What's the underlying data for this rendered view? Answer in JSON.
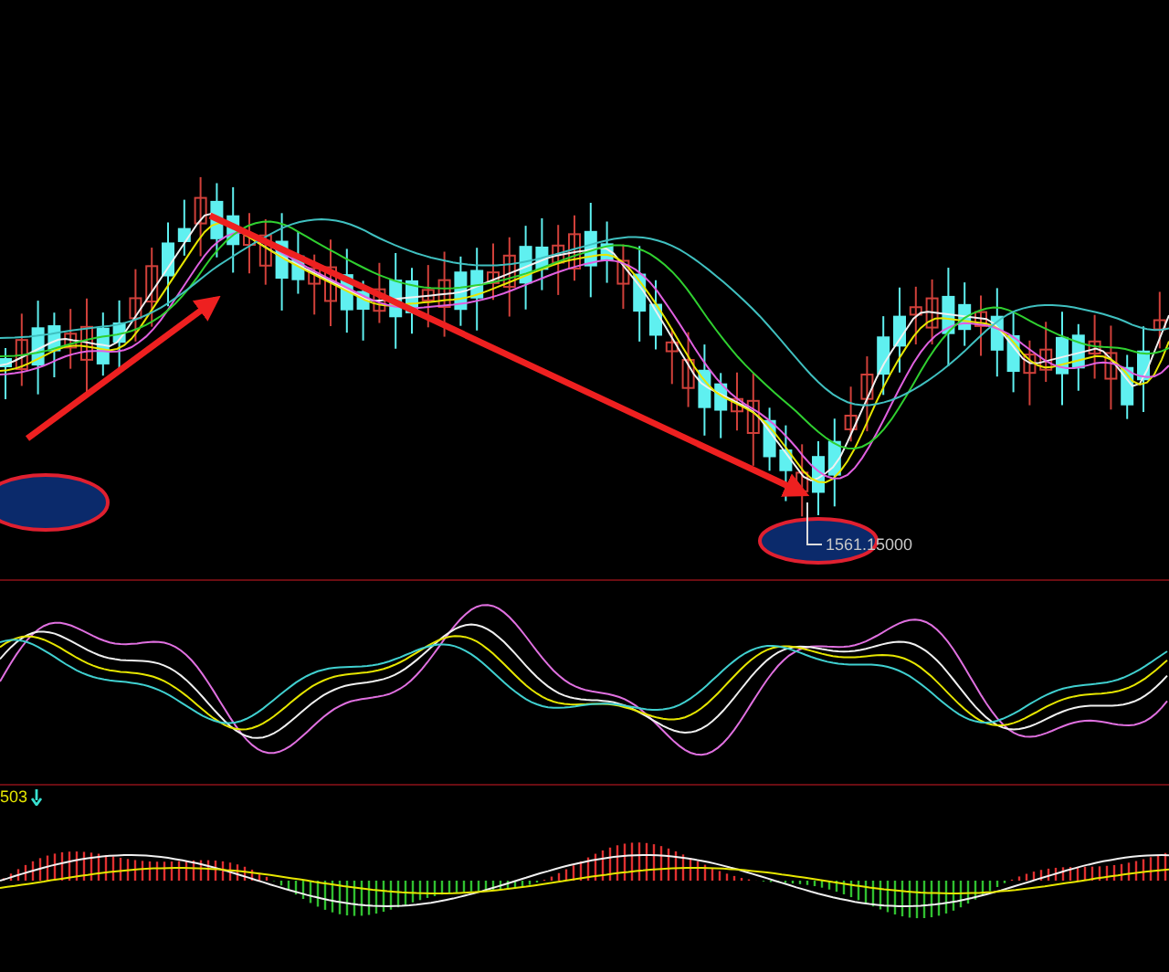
{
  "main_chart": {
    "low_label": "1561.15000"
  },
  "macd_panel": {
    "value": "503"
  }
}
